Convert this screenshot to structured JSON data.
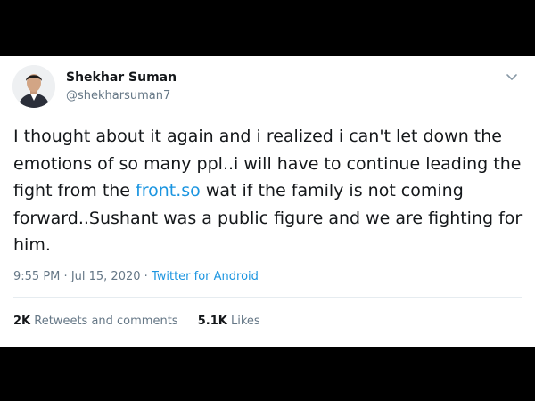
{
  "tweet": {
    "author_name": "Shekhar Suman",
    "author_handle": "@shekharsuman7",
    "text_before_link": "I thought about it again and i realized i can't let down the emotions of so many ppl..i will have to continue leading the fight from the ",
    "link_text": "front.so",
    "text_after_link": " wat if the family is not coming forward..Sushant was a public figure and we are fighting for him.",
    "time": "9:55 PM",
    "separator": "·",
    "date": "Jul 15, 2020",
    "source": "Twitter for Android"
  },
  "stats": {
    "retweets_count": "2K",
    "retweets_label": "Retweets and comments",
    "likes_count": "5.1K",
    "likes_label": "Likes"
  },
  "colors": {
    "link": "#1b95e0",
    "text": "#14171a",
    "secondary": "#657786",
    "divider": "#e6ecf0",
    "letterbox": "#000000"
  },
  "icons": {
    "avatar": "profile-photo",
    "menu": "chevron-down-icon"
  }
}
